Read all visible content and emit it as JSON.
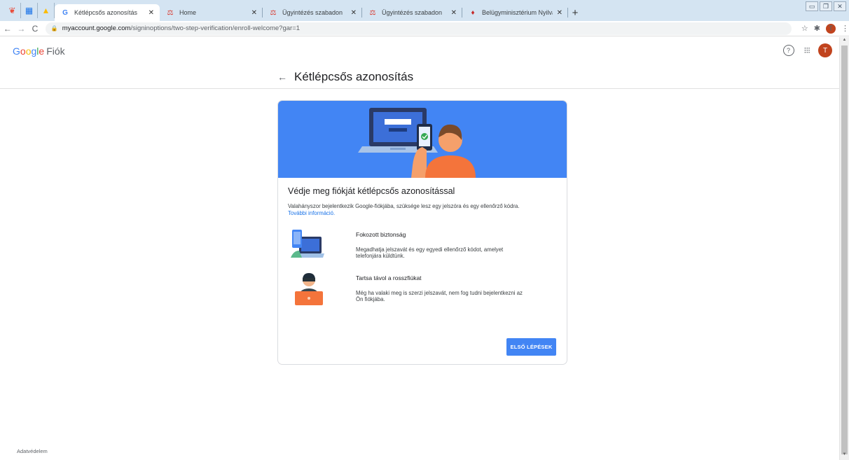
{
  "browser": {
    "pinned_tabs": [
      "pinned-app-1",
      "pinned-app-2",
      "pinned-app-3"
    ],
    "tabs": [
      {
        "title": "Kétlépcsős azonosítás",
        "favicon": "G",
        "active": true
      },
      {
        "title": "Home",
        "favicon": "scales",
        "active": false
      },
      {
        "title": "Ügyintézés szabadon",
        "favicon": "scales",
        "active": false
      },
      {
        "title": "Ügyintézés szabadon",
        "favicon": "scales",
        "active": false
      },
      {
        "title": "Belügyminisztérium Nyilvántartás",
        "favicon": "crest",
        "active": false
      }
    ],
    "close_glyph": "✕",
    "newtab_glyph": "+",
    "url_host": "myaccount.google.com",
    "url_path": "/signinoptions/two-step-verification/enroll-welcome?gar=1",
    "avatar_letter": "T"
  },
  "header": {
    "logo_google": [
      "G",
      "o",
      "o",
      "g",
      "l",
      "e"
    ],
    "logo_product": "Fiók",
    "avatar_letter": "T"
  },
  "page": {
    "back_glyph": "←",
    "title": "Kétlépcsős azonosítás"
  },
  "card": {
    "heading": "Védje meg fiókját kétlépcsős azonosítással",
    "description": "Valahányszor bejelentkezik Google-fiókjába, szüksége lesz egy jelszóra és egy ellenőrző kódra.",
    "more_link": "További információ.",
    "features": [
      {
        "title": "Fokozott biztonság",
        "text": "Megadhatja jelszavát és egy egyedi ellenőrző kódot, amelyet telefonjára küldtünk."
      },
      {
        "title": "Tartsa távol a rosszfiúkat",
        "text": "Még ha valaki meg is szerzi jelszavát, nem fog tudni bejelentkezni az Ön fiókjába."
      }
    ],
    "cta": "ELSŐ LÉPÉSEK"
  },
  "footer": {
    "privacy": "Adatvédelem"
  },
  "colors": {
    "brand_blue": "#4285f4",
    "link_blue": "#1a73e8",
    "avatar": "#c1441e"
  }
}
